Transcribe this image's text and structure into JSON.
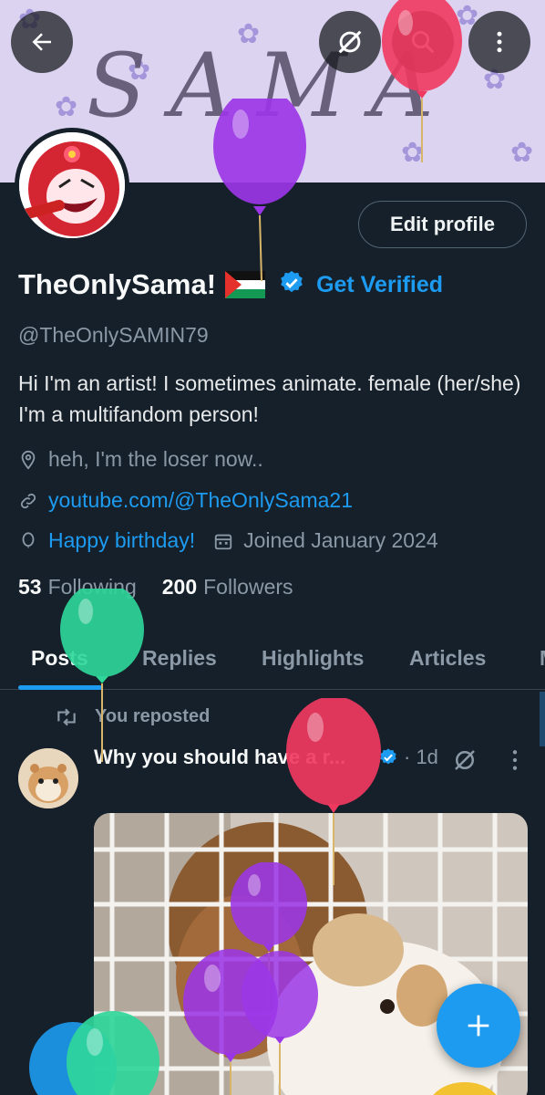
{
  "header": {
    "back_icon": "arrow-left-icon",
    "grok_icon": "grok-icon",
    "search_icon": "search-icon",
    "more_icon": "more-vertical-icon",
    "banner_text": "SAMA"
  },
  "profile": {
    "display_name": "TheOnlySama!",
    "flag": "palestine-flag",
    "get_verified_label": "Get Verified",
    "edit_profile_label": "Edit profile",
    "handle": "@TheOnlySAMIN79",
    "bio": "Hi I'm an artist! I sometimes animate.  female (her/she) I'm a multifandom person!",
    "location": "heh, I'm the loser now..",
    "website": "youtube.com/@TheOnlySama21",
    "birthday": "Happy birthday!",
    "joined": "Joined January 2024",
    "following_count": "53",
    "following_label": "Following",
    "followers_count": "200",
    "followers_label": "Followers"
  },
  "tabs": [
    {
      "label": "Posts",
      "active": true
    },
    {
      "label": "Replies",
      "active": false
    },
    {
      "label": "Highlights",
      "active": false
    },
    {
      "label": "Articles",
      "active": false
    },
    {
      "label": "M",
      "active": false
    }
  ],
  "post": {
    "repost_label": "You reposted",
    "title": "Why you should have a r...",
    "time": "· 1d"
  },
  "colors": {
    "background": "#15202b",
    "accent": "#1d9bf0",
    "muted": "#8b98a5",
    "balloon_purple": "#9b36e6",
    "balloon_red": "#f0395f",
    "balloon_green": "#2fd69a"
  }
}
